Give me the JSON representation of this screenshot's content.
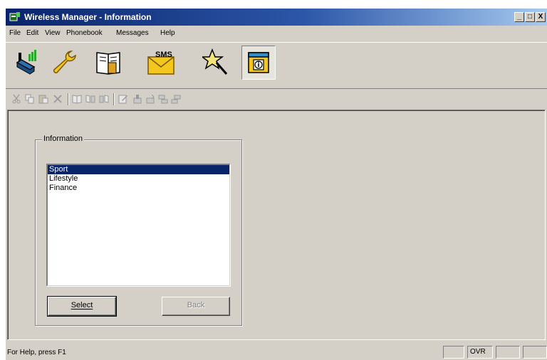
{
  "window": {
    "title": "Wireless Manager - Information",
    "caption_buttons": [
      "_",
      "□",
      "X"
    ]
  },
  "menu": [
    "File",
    "Edit",
    "View",
    "Phonebook",
    "Messages",
    "Help"
  ],
  "big_toolbar": {
    "icons": [
      "phone-connect-icon",
      "wrench-settings-icon",
      "phonebook-icon",
      "sms-envelope-icon",
      "magic-wand-icon",
      "information-window-icon"
    ],
    "sms_label": "SMS",
    "active": "information-window-icon"
  },
  "small_toolbar": {
    "icons": [
      "cut-icon",
      "copy-icon",
      "paste-icon",
      "delete-icon",
      "phonebook-view-icon",
      "copy-to-phone-icon",
      "copy-from-phone-icon",
      "edit-icon",
      "upload-icon",
      "download-icon",
      "transfer-left-icon",
      "transfer-right-icon"
    ]
  },
  "information": {
    "group_label": "Information",
    "items": [
      "Sport",
      "Lifestyle",
      "Finance"
    ],
    "selected_index": 0,
    "select_button": "Select",
    "back_button": "Back"
  },
  "status": {
    "help_text": "For Help, press F1",
    "panes": [
      "",
      "OVR",
      "",
      ""
    ]
  },
  "colors": {
    "title_active": "#0a246a",
    "face": "#d4d0c8",
    "selection": "#0a246a"
  }
}
